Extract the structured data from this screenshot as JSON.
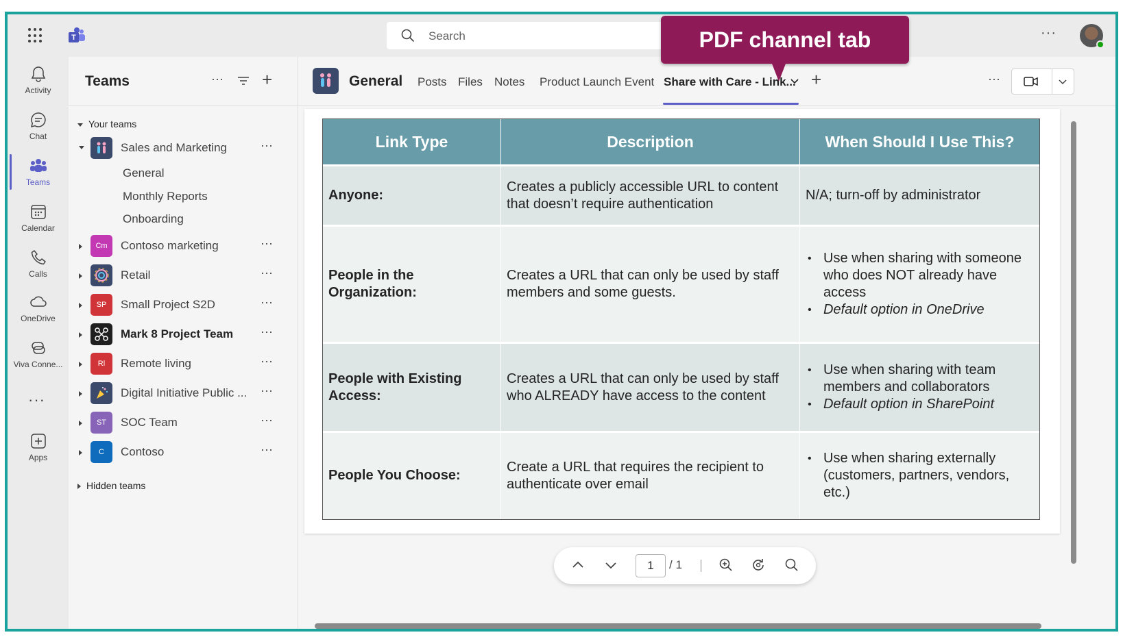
{
  "callout": {
    "label": "PDF channel tab"
  },
  "topbar": {
    "search_placeholder": "Search"
  },
  "rail": {
    "items": [
      {
        "label": "Activity"
      },
      {
        "label": "Chat"
      },
      {
        "label": "Teams"
      },
      {
        "label": "Calendar"
      },
      {
        "label": "Calls"
      },
      {
        "label": "OneDrive"
      },
      {
        "label": "Viva Conne..."
      },
      {
        "label": "Apps"
      }
    ]
  },
  "panel": {
    "title": "Teams",
    "your_teams_label": "Your teams",
    "hidden_teams_label": "Hidden teams",
    "teams": [
      {
        "name": "Sales and Marketing",
        "initials": "",
        "color": "#3b4a6b"
      },
      {
        "name": "Contoso marketing",
        "initials": "Cm",
        "color": "#c239b3"
      },
      {
        "name": "Retail",
        "initials": "",
        "color": "#3b4a6b"
      },
      {
        "name": "Small Project S2D",
        "initials": "SP",
        "color": "#d13438"
      },
      {
        "name": "Mark 8 Project Team",
        "initials": "",
        "color": "#1f1f1f"
      },
      {
        "name": "Remote living",
        "initials": "Rl",
        "color": "#d13438"
      },
      {
        "name": "Digital Initiative Public ...",
        "initials": "",
        "color": "#3b4a6b"
      },
      {
        "name": "SOC Team",
        "initials": "ST",
        "color": "#8764b8"
      },
      {
        "name": "Contoso",
        "initials": "C",
        "color": "#0f6cbd"
      }
    ],
    "channels": [
      "General",
      "Monthly Reports",
      "Onboarding"
    ]
  },
  "header": {
    "channel_name": "General",
    "tabs": [
      "Posts",
      "Files",
      "Notes",
      "Product Launch Event",
      "Share with Care - Link..."
    ]
  },
  "table": {
    "headers": [
      "Link Type",
      "Description",
      "When Should I Use This?"
    ],
    "rows": [
      {
        "type": "Anyone:",
        "description": "Creates a publicly accessible URL to content that doesn’t require authentication",
        "when_text": "N/A; turn-off by administrator"
      },
      {
        "type": "People in the Organization:",
        "description": "Creates a URL that can only be used by staff members and some guests.",
        "when_bullets": [
          "Use when sharing with someone who does NOT already have access",
          "Default option in OneDrive"
        ]
      },
      {
        "type": "People with Existing Access:",
        "description": "Creates a URL that can only be used by staff who ALREADY have access to the content",
        "when_bullets": [
          "Use when sharing with team members and collaborators",
          "Default option in SharePoint"
        ]
      },
      {
        "type": "People You Choose:",
        "description": "Create a URL that requires the recipient to authenticate over email",
        "when_bullets": [
          "Use when sharing externally (customers, partners, vendors, etc.)"
        ]
      }
    ]
  },
  "pdf_toolbar": {
    "page": "1",
    "total": "/ 1"
  },
  "colors": {
    "accent": "#5b5fc7",
    "frame": "#1aa39c",
    "callout": "#8e1b57",
    "table_header": "#679ca8"
  }
}
